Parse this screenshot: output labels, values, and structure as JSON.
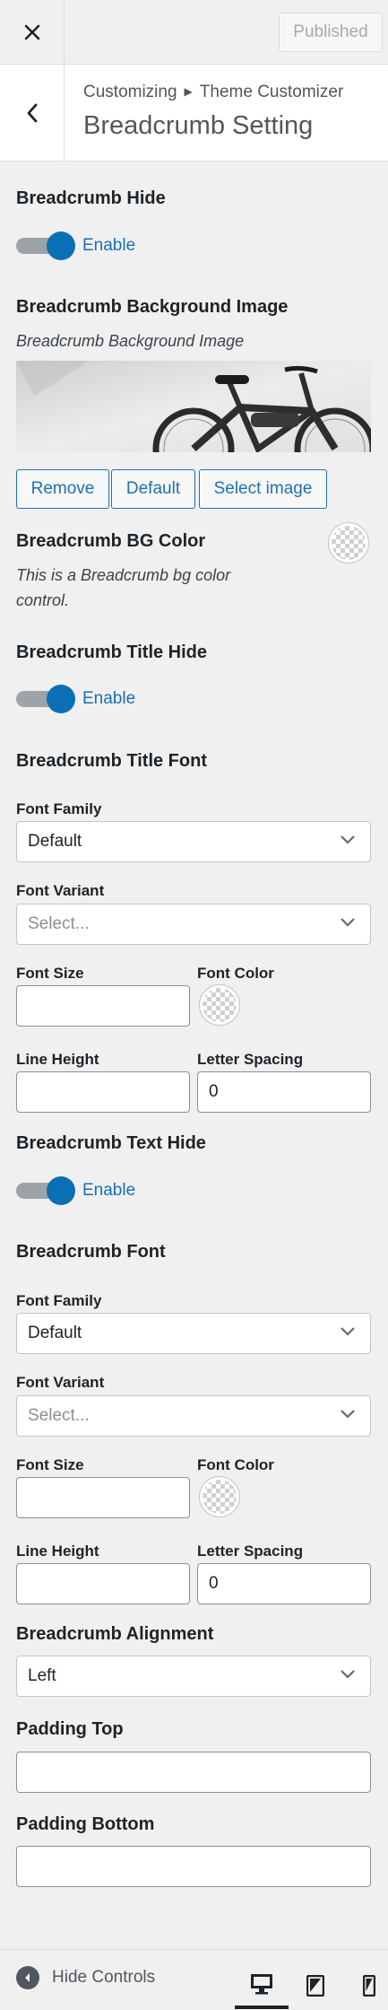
{
  "header": {
    "close_icon": "close-icon",
    "publish_label": "Published"
  },
  "section": {
    "breadcrumb_root": "Customizing",
    "breadcrumb_parent": "Theme Customizer",
    "title": "Breadcrumb Setting"
  },
  "controls": {
    "breadcrumb_hide": {
      "label": "Breadcrumb Hide",
      "toggle_label": "Enable",
      "on": true
    },
    "bg_image": {
      "label": "Breadcrumb Background Image",
      "description": "Breadcrumb Background Image",
      "remove": "Remove",
      "default": "Default",
      "select": "Select image"
    },
    "bg_color": {
      "label": "Breadcrumb BG Color",
      "description": "This is a Breadcrumb bg color control."
    },
    "title_hide": {
      "label": "Breadcrumb Title Hide",
      "toggle_label": "Enable",
      "on": true
    },
    "title_font": {
      "label": "Breadcrumb Title Font",
      "font_family_label": "Font Family",
      "font_family_value": "Default",
      "font_variant_label": "Font Variant",
      "font_variant_placeholder": "Select...",
      "font_size_label": "Font Size",
      "font_size_value": "",
      "font_color_label": "Font Color",
      "line_height_label": "Line Height",
      "line_height_value": "",
      "letter_spacing_label": "Letter Spacing",
      "letter_spacing_value": "0"
    },
    "text_hide": {
      "label": "Breadcrumb Text Hide",
      "toggle_label": "Enable",
      "on": true
    },
    "font": {
      "label": "Breadcrumb Font",
      "font_family_label": "Font Family",
      "font_family_value": "Default",
      "font_variant_label": "Font Variant",
      "font_variant_placeholder": "Select...",
      "font_size_label": "Font Size",
      "font_size_value": "",
      "font_color_label": "Font Color",
      "line_height_label": "Line Height",
      "line_height_value": "",
      "letter_spacing_label": "Letter Spacing",
      "letter_spacing_value": "0"
    },
    "alignment": {
      "label": "Breadcrumb Alignment",
      "value": "Left"
    },
    "padding_top": {
      "label": "Padding Top",
      "value": ""
    },
    "padding_bottom": {
      "label": "Padding Bottom",
      "value": ""
    }
  },
  "footer": {
    "hide_controls": "Hide Controls",
    "devices": [
      "desktop-icon",
      "tablet-icon",
      "mobile-icon"
    ],
    "active_device": "desktop"
  },
  "colors": {
    "accent": "#2271b1",
    "toggle_knob": "#0a6fb5",
    "background": "#f0f0f1"
  }
}
